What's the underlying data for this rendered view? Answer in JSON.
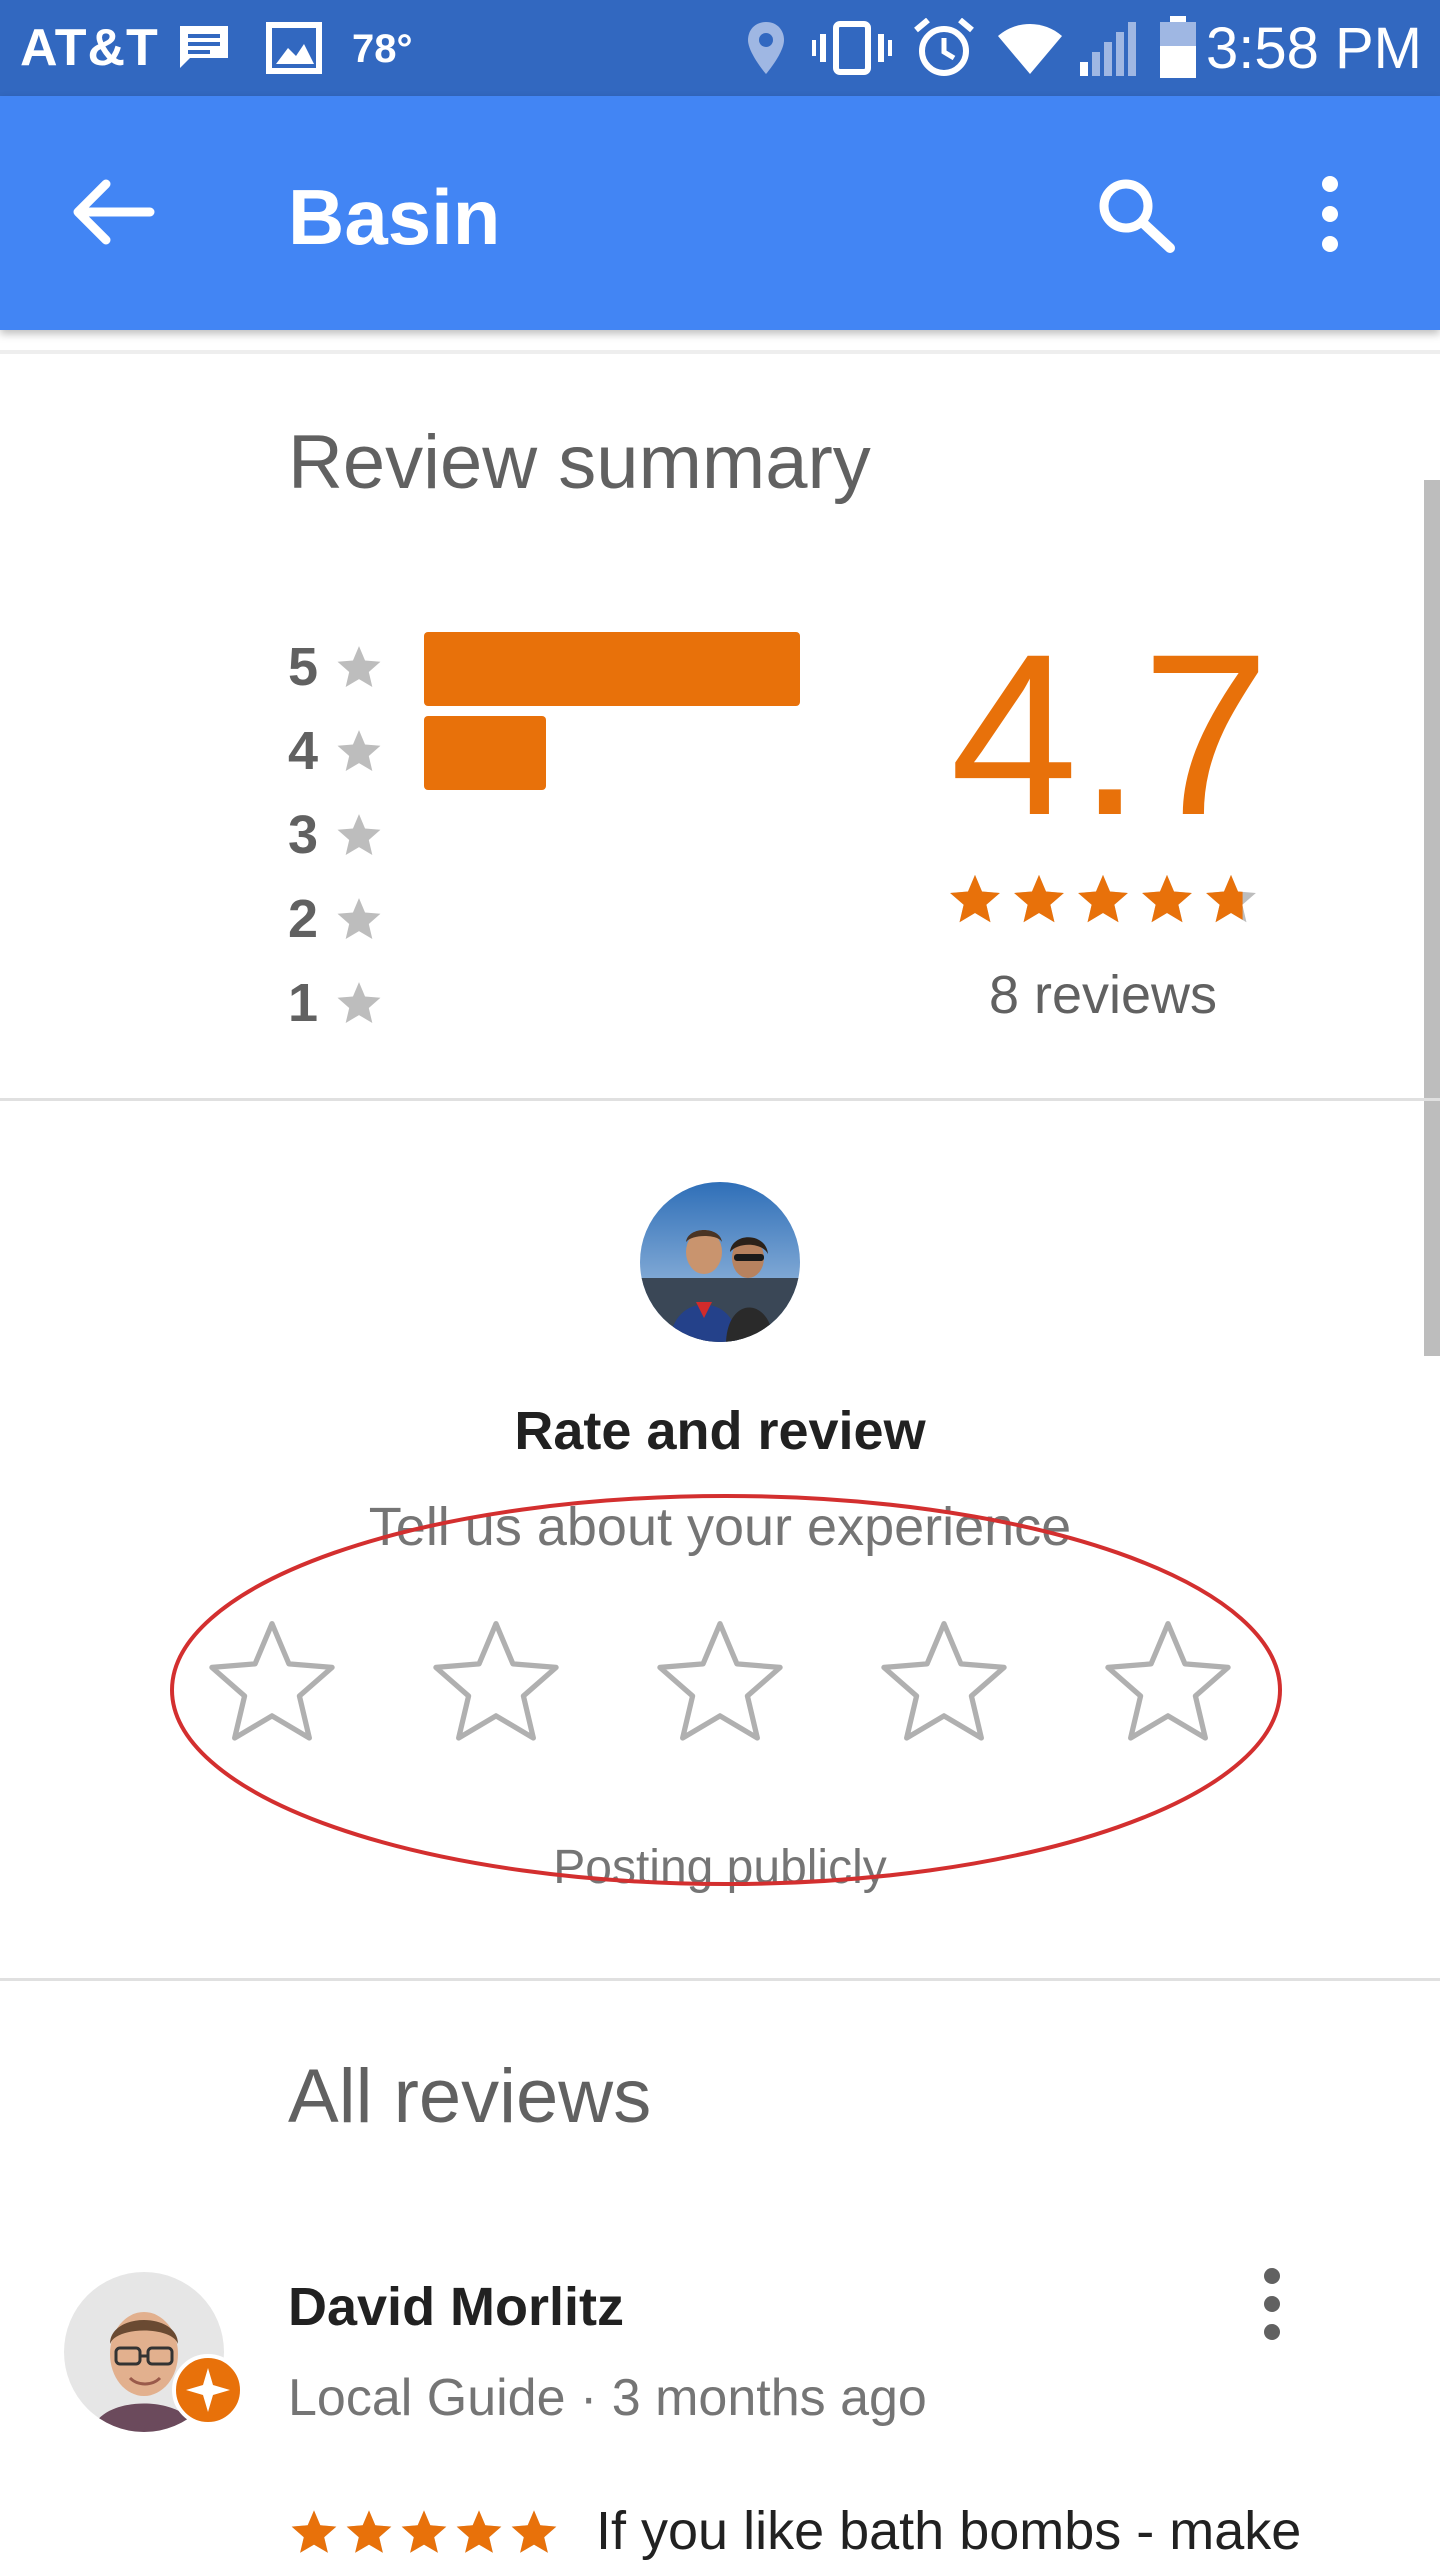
{
  "status_bar": {
    "carrier": "AT&T",
    "temperature": "78°",
    "time": "3:58 PM",
    "icons": [
      "message-icon",
      "image-icon",
      "location-icon",
      "vibrate-icon",
      "alarm-icon",
      "wifi-icon",
      "signal-icon",
      "battery-icon"
    ]
  },
  "app_bar": {
    "title": "Basin",
    "icons": [
      "back-arrow-icon",
      "search-icon",
      "more-vert-icon"
    ]
  },
  "review_summary": {
    "title": "Review summary",
    "distribution": [
      {
        "stars": "5",
        "share": 0.8
      },
      {
        "stars": "4",
        "share": 0.26
      },
      {
        "stars": "3",
        "share": 0
      },
      {
        "stars": "2",
        "share": 0
      },
      {
        "stars": "1",
        "share": 0
      }
    ],
    "average": "4.7",
    "average_stars": 4.7,
    "review_count": "8 reviews"
  },
  "rate_and_review": {
    "title": "Rate and review",
    "subtitle": "Tell us about your experience",
    "star_count": 5,
    "footer": "Posting publicly"
  },
  "all_reviews": {
    "title": "All reviews",
    "reviews": [
      {
        "author": "David Morlitz",
        "meta": "Local Guide · 3 months ago",
        "stars": 5,
        "text": "If you like bath bombs - make"
      }
    ]
  },
  "colors": {
    "status_bar": "#3268c0",
    "app_bar": "#4285f4",
    "accent_orange": "#e8710a",
    "annotation_red": "#d32f2f"
  }
}
